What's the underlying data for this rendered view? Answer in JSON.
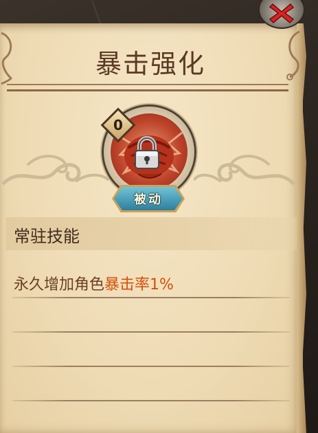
{
  "window": {
    "title": "暴击强化",
    "close_icon": "close-x-icon"
  },
  "skill": {
    "level": "0",
    "icon": "fist-icon",
    "locked": true,
    "lock_icon": "padlock-icon",
    "tag": "被动",
    "type_label": "常驻技能",
    "description_prefix": "永久增加角色",
    "description_highlight": "暴击率1%"
  },
  "colors": {
    "title": "#5a3a24",
    "highlight": "#d2500c",
    "description": "#6b4024",
    "tag": "#2f7f9c",
    "close": "#d62424"
  }
}
